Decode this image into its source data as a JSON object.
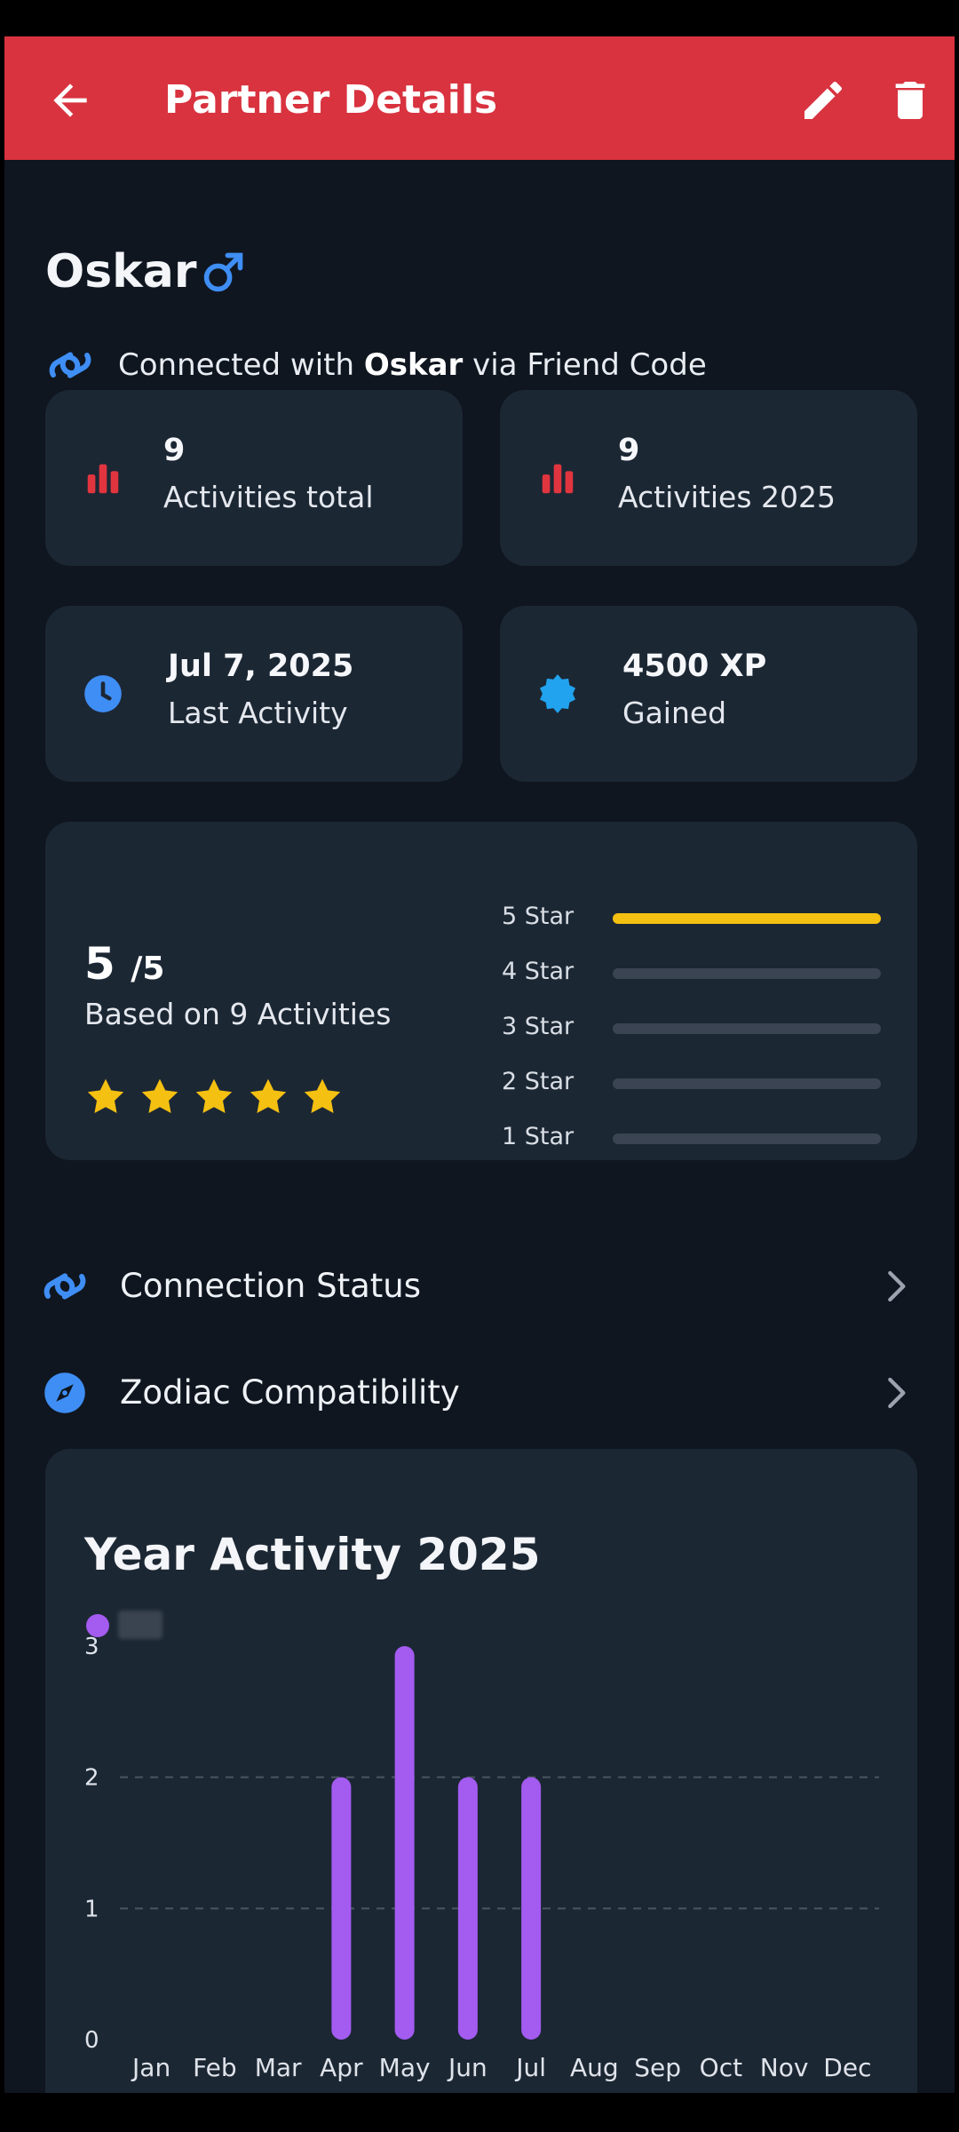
{
  "appbar": {
    "title": "Partner Details",
    "back_icon": "arrow-left-icon",
    "edit_icon": "pencil-icon",
    "delete_icon": "trash-icon",
    "color": "#d8333f"
  },
  "partner": {
    "name": "Oskar",
    "gender_icon": "male-icon",
    "connection_prefix": "Connected with ",
    "connection_name": "Oskar",
    "connection_suffix": " via Friend Code"
  },
  "stats": [
    {
      "icon": "bar-chart-icon",
      "value": "9",
      "label": "Activities total"
    },
    {
      "icon": "bar-chart-icon",
      "value": "9",
      "label": "Activities 2025"
    },
    {
      "icon": "clock-icon",
      "value": "Jul 7, 2025",
      "label": "Last Activity"
    },
    {
      "icon": "badge-icon",
      "value": "4500 XP",
      "label": "Gained"
    }
  ],
  "rating": {
    "value": "5",
    "max_label": "/5",
    "based_on": "Based on 9 Activities",
    "stars_filled": 5,
    "breakdown": [
      {
        "label": "5 Star",
        "fraction": 1.0
      },
      {
        "label": "4 Star",
        "fraction": 0
      },
      {
        "label": "3 Star",
        "fraction": 0
      },
      {
        "label": "2 Star",
        "fraction": 0
      },
      {
        "label": "1 Star",
        "fraction": 0
      }
    ],
    "star_color": "#f4c011"
  },
  "menu": [
    {
      "icon": "link-icon",
      "label": "Connection Status"
    },
    {
      "icon": "compass-icon",
      "label": "Zodiac Compatibility"
    }
  ],
  "chart_data": {
    "type": "bar",
    "title": "Year Activity 2025",
    "categories": [
      "Jan",
      "Feb",
      "Mar",
      "Apr",
      "May",
      "Jun",
      "Jul",
      "Aug",
      "Sep",
      "Oct",
      "Nov",
      "Dec"
    ],
    "series": [
      {
        "values": [
          0,
          0,
          0,
          2,
          3,
          2,
          2,
          0,
          0,
          0,
          0,
          0
        ],
        "color": "#a35bf0"
      }
    ],
    "yticks": [
      "0",
      "1",
      "2",
      "3"
    ],
    "ylim": [
      0,
      3
    ],
    "grid": true,
    "legend": "top-left"
  }
}
